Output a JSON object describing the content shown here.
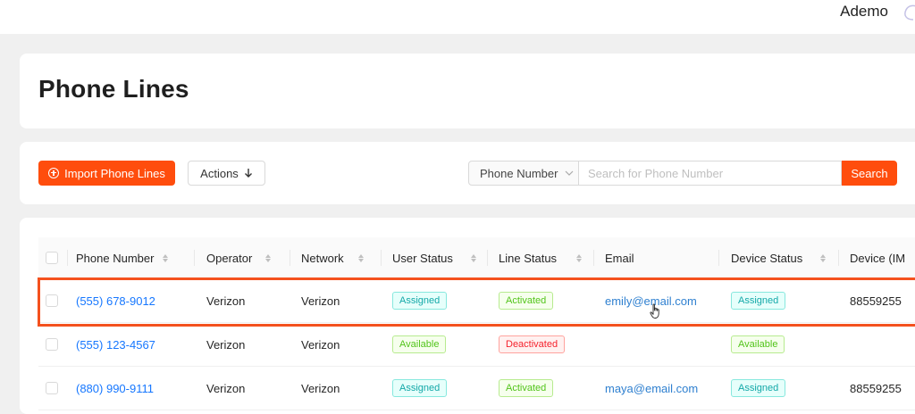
{
  "header": {
    "user_name": "Ademo"
  },
  "page": {
    "title": "Phone Lines"
  },
  "toolbar": {
    "import_label": "Import Phone Lines",
    "actions_label": "Actions",
    "search_field": "Phone Number",
    "search_placeholder": "Search for Phone Number",
    "search_button": "Search"
  },
  "table": {
    "columns": [
      "Phone Number",
      "Operator",
      "Network",
      "User Status",
      "Line Status",
      "Email",
      "Device Status",
      "Device (IM"
    ],
    "rows": [
      {
        "phone": "(555) 678-9012",
        "operator": "Verizon",
        "network": "Verizon",
        "user_status": "Assigned",
        "line_status": "Activated",
        "email": "emily@email.com",
        "device_status": "Assigned",
        "device": "88559255"
      },
      {
        "phone": "(555) 123-4567",
        "operator": "Verizon",
        "network": "Verizon",
        "user_status": "Available",
        "line_status": "Deactivated",
        "email": "",
        "device_status": "Available",
        "device": ""
      },
      {
        "phone": "(880) 990-9111",
        "operator": "Verizon",
        "network": "Verizon",
        "user_status": "Assigned",
        "line_status": "Activated",
        "email": "maya@email.com",
        "device_status": "Assigned",
        "device": "88559255"
      }
    ]
  },
  "colors": {
    "accent": "#ff4d0d",
    "highlight": "#f4511e",
    "link": "#1677ff"
  }
}
